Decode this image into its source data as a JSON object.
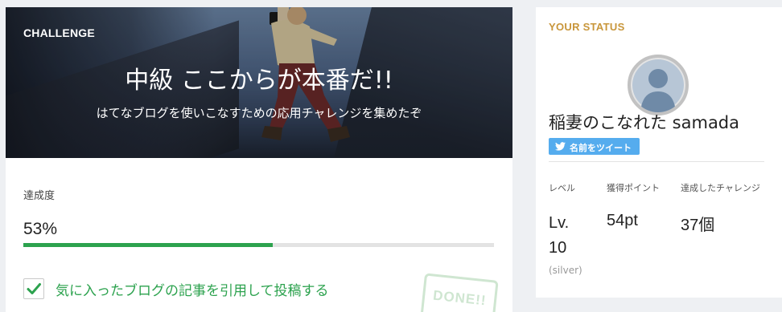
{
  "challenge": {
    "kicker": "CHALLENGE",
    "title": "中級 ここからが本番だ!!",
    "subtitle": "はてなブログを使いこなすための応用チャレンジを集めたぞ"
  },
  "progress": {
    "label": "達成度",
    "value_text": "53%",
    "value": 0.53,
    "fill_color": "#2ca24e"
  },
  "tasks": [
    {
      "label": "気に入ったブログの記事を引用して投稿する",
      "checked": true,
      "stamp": "DONE!!"
    }
  ],
  "status": {
    "heading": "YOUR STATUS",
    "avatar_icon": "user-silhouette-icon",
    "user_name": "稲妻のこなれた samada",
    "tweet_button": "名前をツイート",
    "stats": [
      {
        "label": "レベル",
        "value_line1": "Lv.",
        "value_line2": "10",
        "sub": "(silver)"
      },
      {
        "label": "獲得ポイント",
        "value": "54pt"
      },
      {
        "label": "達成したチャレンジ",
        "value": "37個"
      }
    ]
  },
  "colors": {
    "accent_green": "#2ca24e",
    "status_heading": "#c8963b",
    "twitter_blue": "#55acee"
  }
}
